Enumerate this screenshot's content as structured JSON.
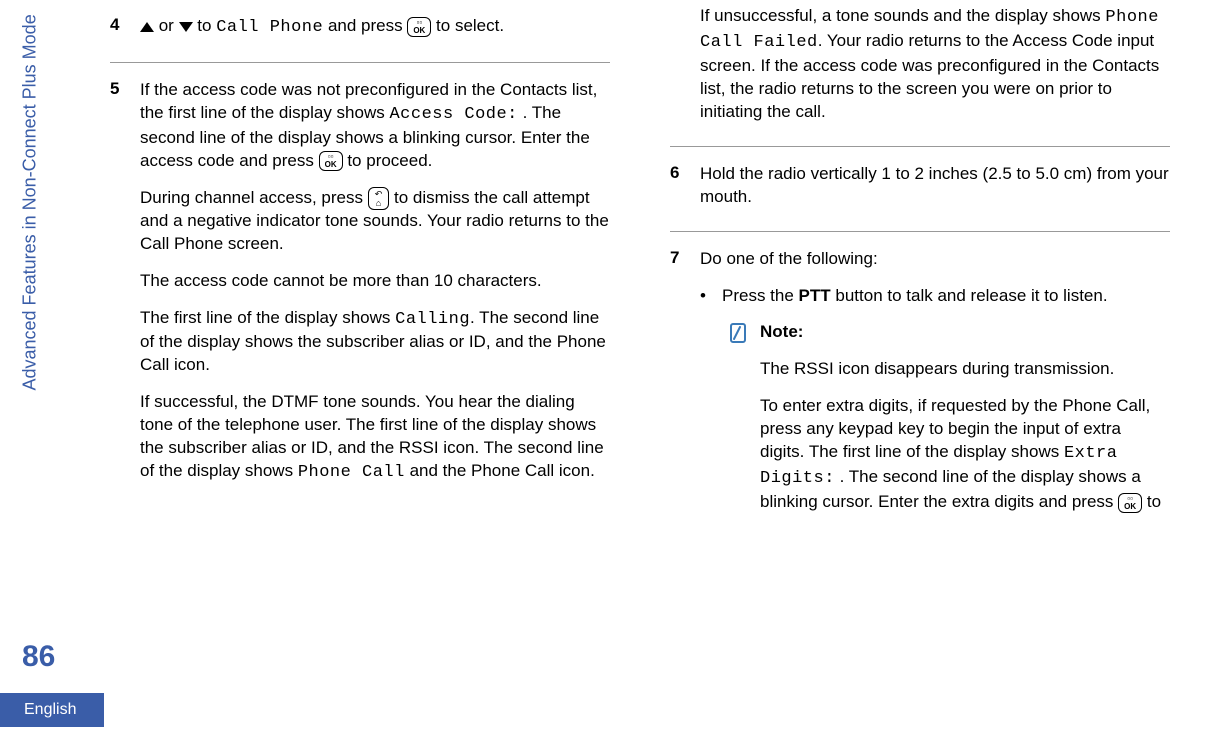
{
  "sidebar": {
    "section_title": "Advanced Features in Non-Connect Plus Mode"
  },
  "page": {
    "number": "86",
    "language": "English"
  },
  "left_column": {
    "step4": {
      "num": "4",
      "text_prefix": "",
      "or": " or ",
      "to": " to ",
      "call_phone": "Call Phone",
      "and_press": " and press ",
      "to_select": " to select."
    },
    "step5": {
      "num": "5",
      "p1_a": "If the access code was not preconfigured in the Contacts list, the first line of the display shows ",
      "access_code": "Access Code:",
      "p1_b": " . The second line of the display shows a blinking cursor. Enter the access code and press ",
      "p1_c": " to proceed.",
      "p2_a": "During channel access, press ",
      "p2_b": " to dismiss the call attempt and a negative indicator tone sounds. Your radio returns to the Call Phone screen.",
      "p3": "The access code cannot be more than 10 characters.",
      "p4_a": "The first line of the display shows ",
      "calling": "Calling",
      "p4_b": ". The second line of the display shows the subscriber alias or ID, and the Phone Call icon.",
      "p5_a": "If successful, the DTMF tone sounds. You hear the dialing tone of the telephone user. The first line of the display shows the subscriber alias or ID, and the RSSI icon. The second line of the display shows ",
      "phone_call": "Phone Call",
      "p5_b": " and the Phone Call icon."
    }
  },
  "right_column": {
    "step5_cont": {
      "p1_a": "If unsuccessful, a tone sounds and the display shows ",
      "phone_call_failed": "Phone Call Failed",
      "p1_b": ". Your radio returns to the Access Code input screen. If the access code was preconfigured in the Contacts list, the radio returns to the screen you were on prior to initiating the call."
    },
    "step6": {
      "num": "6",
      "text": "Hold the radio vertically 1 to 2 inches (2.5 to 5.0 cm) from your mouth."
    },
    "step7": {
      "num": "7",
      "intro": "Do one of the following:",
      "bullet1_a": "Press the ",
      "ptt": "PTT",
      "bullet1_b": " button to talk and release it to listen.",
      "note_title": "Note:",
      "note_p1": "The RSSI icon disappears during transmission.",
      "note_p2_a": "To enter extra digits, if requested by the Phone Call, press any keypad key to begin the input of extra digits. The first line of the display shows ",
      "extra_digits": "Extra Digits:",
      "note_p2_b": " . The second line of the display shows a blinking cursor. Enter the extra digits and press ",
      "note_p2_c": " to"
    }
  }
}
